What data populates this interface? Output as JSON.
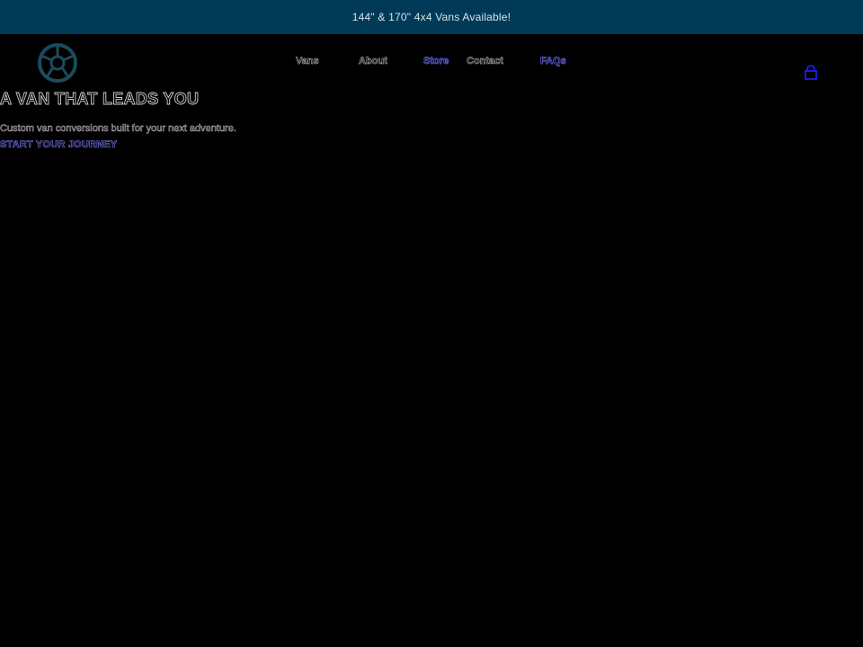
{
  "announcement": {
    "text": "144\" & 170\" 4x4 Vans Available!"
  },
  "header": {
    "nav": [
      {
        "label": "Vans"
      },
      {
        "label": "About"
      },
      {
        "label": "Store"
      },
      {
        "label": "Contact"
      },
      {
        "label": "FAQs"
      }
    ],
    "logo_icon": "steering-wheel-logo-icon",
    "cart_icon": "shopping-bag-icon"
  },
  "hero": {
    "title": "A VAN THAT LEADS YOU",
    "subtitle": "Custom van conversions built for your next adventure.",
    "cta_label": "START YOUR JOURNEY"
  },
  "colors": {
    "announcement_bg": "#003a56",
    "page_bg": "#000000",
    "link_accent": "#6a6aff",
    "logo_teal": "#1c4a5c"
  }
}
